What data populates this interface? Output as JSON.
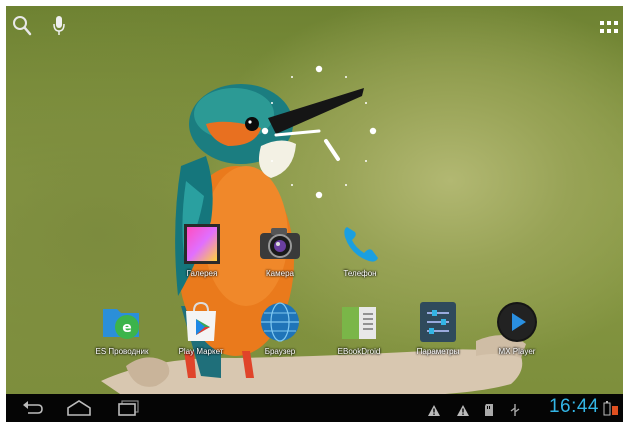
{
  "topbar": {
    "search_icon": "search-icon",
    "mic_icon": "microphone-icon",
    "apps_icon": "all-apps-grid-icon"
  },
  "wallpaper": {
    "subject": "kingfisher-on-branch"
  },
  "clock_widget": {
    "type": "analog-clock"
  },
  "apps": [
    {
      "label": "Галерея",
      "icon": "gallery-icon"
    },
    {
      "label": "Камера",
      "icon": "camera-icon"
    },
    {
      "label": "Телефон",
      "icon": "phone-icon"
    },
    {
      "label": "ES Проводник",
      "icon": "es-file-explorer-icon"
    },
    {
      "label": "Play Маркет",
      "icon": "play-market-icon"
    },
    {
      "label": "Браузер",
      "icon": "browser-globe-icon"
    },
    {
      "label": "EBookDroid",
      "icon": "ebookdroid-icon"
    },
    {
      "label": "Параметры",
      "icon": "settings-icon"
    },
    {
      "label": "MX Player",
      "icon": "mx-player-icon"
    }
  ],
  "navbar": {
    "back_icon": "back-icon",
    "home_icon": "home-icon",
    "recents_icon": "recent-apps-icon"
  },
  "status": {
    "time": "16:44",
    "accent_color": "#33b5e5",
    "icons": [
      "warning-icon",
      "warning-icon",
      "sd-card-icon",
      "usb-debug-icon",
      "battery-icon"
    ]
  }
}
